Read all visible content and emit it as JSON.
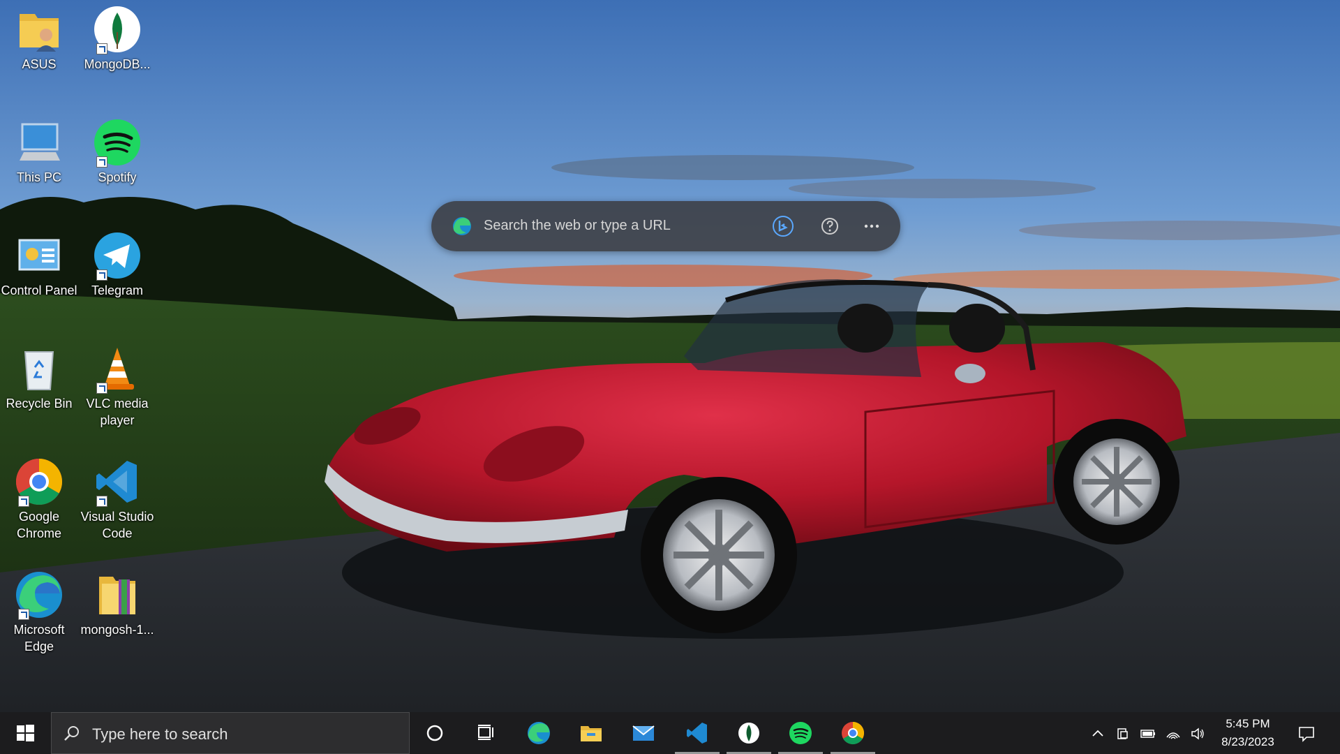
{
  "desktop": {
    "icons": [
      {
        "label": "ASUS"
      },
      {
        "label": "MongoDB..."
      },
      {
        "label": "This PC"
      },
      {
        "label": "Spotify"
      },
      {
        "label": "Control Panel"
      },
      {
        "label": "Telegram"
      },
      {
        "label": "Recycle Bin"
      },
      {
        "label": "VLC media player"
      },
      {
        "label": "Google Chrome"
      },
      {
        "label": "Visual Studio Code"
      },
      {
        "label": "Microsoft Edge"
      },
      {
        "label": "mongosh-1..."
      }
    ]
  },
  "search_pill": {
    "placeholder": "Search the web or type a URL",
    "icons": [
      "edge-icon",
      "bing-icon",
      "help-icon",
      "more-icon"
    ]
  },
  "taskbar": {
    "search_placeholder": "Type here to search",
    "pinned": [
      "cortana",
      "task-view",
      "edge",
      "file-explorer",
      "mail",
      "vscode",
      "mongodb-compass",
      "spotify",
      "chrome"
    ],
    "clock_time": "5:45 PM",
    "clock_date": "8/23/2023"
  },
  "colors": {
    "taskbar_bg": "#1c1c1e",
    "car_red": "#b5162a",
    "sky_top": "#4a7ec2",
    "sunset": "#f06a2a"
  }
}
